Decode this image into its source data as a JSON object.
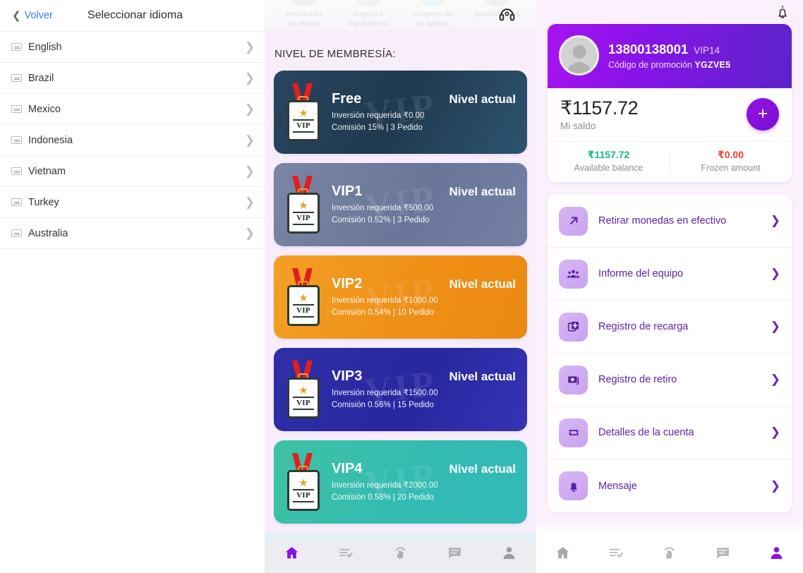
{
  "left_panel": {
    "back_label": "Volver",
    "title": "Seleccionar idioma",
    "languages": [
      {
        "name": "English"
      },
      {
        "name": "Brazil"
      },
      {
        "name": "Mexico"
      },
      {
        "name": "Indonesia"
      },
      {
        "name": "Vietnam"
      },
      {
        "name": "Turkey"
      },
      {
        "name": "Australia"
      }
    ]
  },
  "mid_panel": {
    "quick_links": [
      {
        "line1": "Introdução",
        "line2": "da Plataf"
      },
      {
        "line1": "Regras e",
        "line2": "regulamento"
      },
      {
        "line1": "Cooperação",
        "line2": "de agente"
      },
      {
        "line1": "Qualificações",
        "line2": ""
      }
    ],
    "support_icon": "headset-icon",
    "section_title": "NIVEL DE MEMBRESÍA:",
    "watermark": "VIP",
    "levels": [
      {
        "name": "Free",
        "status": "Nivel actual",
        "investment": "Inversión requerida ₹0.00",
        "commission": "Comisión 15% | 3 Pedido",
        "color": "#26415a"
      },
      {
        "name": "VIP1",
        "status": "Nivel actual",
        "investment": "Inversión requerida ₹500.00",
        "commission": "Comisión 0.52% | 3 Pedido",
        "color": "#6f7b9e"
      },
      {
        "name": "VIP2",
        "status": "Nivel actual",
        "investment": "Inversión requerida ₹1000.00",
        "commission": "Comisión 0.54% | 10 Pedido",
        "color": "#ef9318"
      },
      {
        "name": "VIP3",
        "status": "Nivel actual",
        "investment": "Inversión requerida ₹1500.00",
        "commission": "Comisión 0.56% | 15 Pedido",
        "color": "#2b2ba8"
      },
      {
        "name": "VIP4",
        "status": "Nivel actual",
        "investment": "Inversión requerida ₹2000.00",
        "commission": "Comisión 0.58% | 20 Pedido",
        "color": "#37bdae"
      }
    ],
    "bottom_nav": [
      {
        "icon": "home-icon",
        "active": true
      },
      {
        "icon": "task-list-icon",
        "active": false
      },
      {
        "icon": "grab-hand-icon",
        "active": false
      },
      {
        "icon": "chat-icon",
        "active": false
      },
      {
        "icon": "person-icon",
        "active": false
      }
    ]
  },
  "right_panel": {
    "notification_icon": "bell-icon",
    "account": {
      "phone": "13800138001",
      "vip_level": "VIP14",
      "promo_label": "Código de promoción",
      "promo_code": "YGZVE5",
      "balance_amount": "₹1157.72",
      "balance_label": "Mi saldo",
      "add_button": "+",
      "available_value": "₹1157.72",
      "available_label": "Available balance",
      "frozen_value": "₹0.00",
      "frozen_label": "Frozen amount",
      "available_color": "#12b886",
      "frozen_color": "#f0412d",
      "gradient_from": "#a613f0",
      "gradient_to": "#5c23c9"
    },
    "menu": [
      {
        "label": "Retirar monedas en efectivo",
        "icon": "arrow-up-right-icon"
      },
      {
        "label": "Informe del equipo",
        "icon": "team-icon"
      },
      {
        "label": "Registro de recarga",
        "icon": "recharge-plus-icon"
      },
      {
        "label": "Registro de retiro",
        "icon": "withdraw-record-icon"
      },
      {
        "label": "Detalles de la cuenta",
        "icon": "exchange-arrows-icon"
      },
      {
        "label": "Mensaje",
        "icon": "bell-filled-icon"
      }
    ],
    "bottom_nav": [
      {
        "icon": "home-icon",
        "active": false
      },
      {
        "icon": "task-list-icon",
        "active": false
      },
      {
        "icon": "grab-hand-icon",
        "active": false
      },
      {
        "icon": "chat-icon",
        "active": false
      },
      {
        "icon": "person-icon",
        "active": true
      }
    ]
  }
}
